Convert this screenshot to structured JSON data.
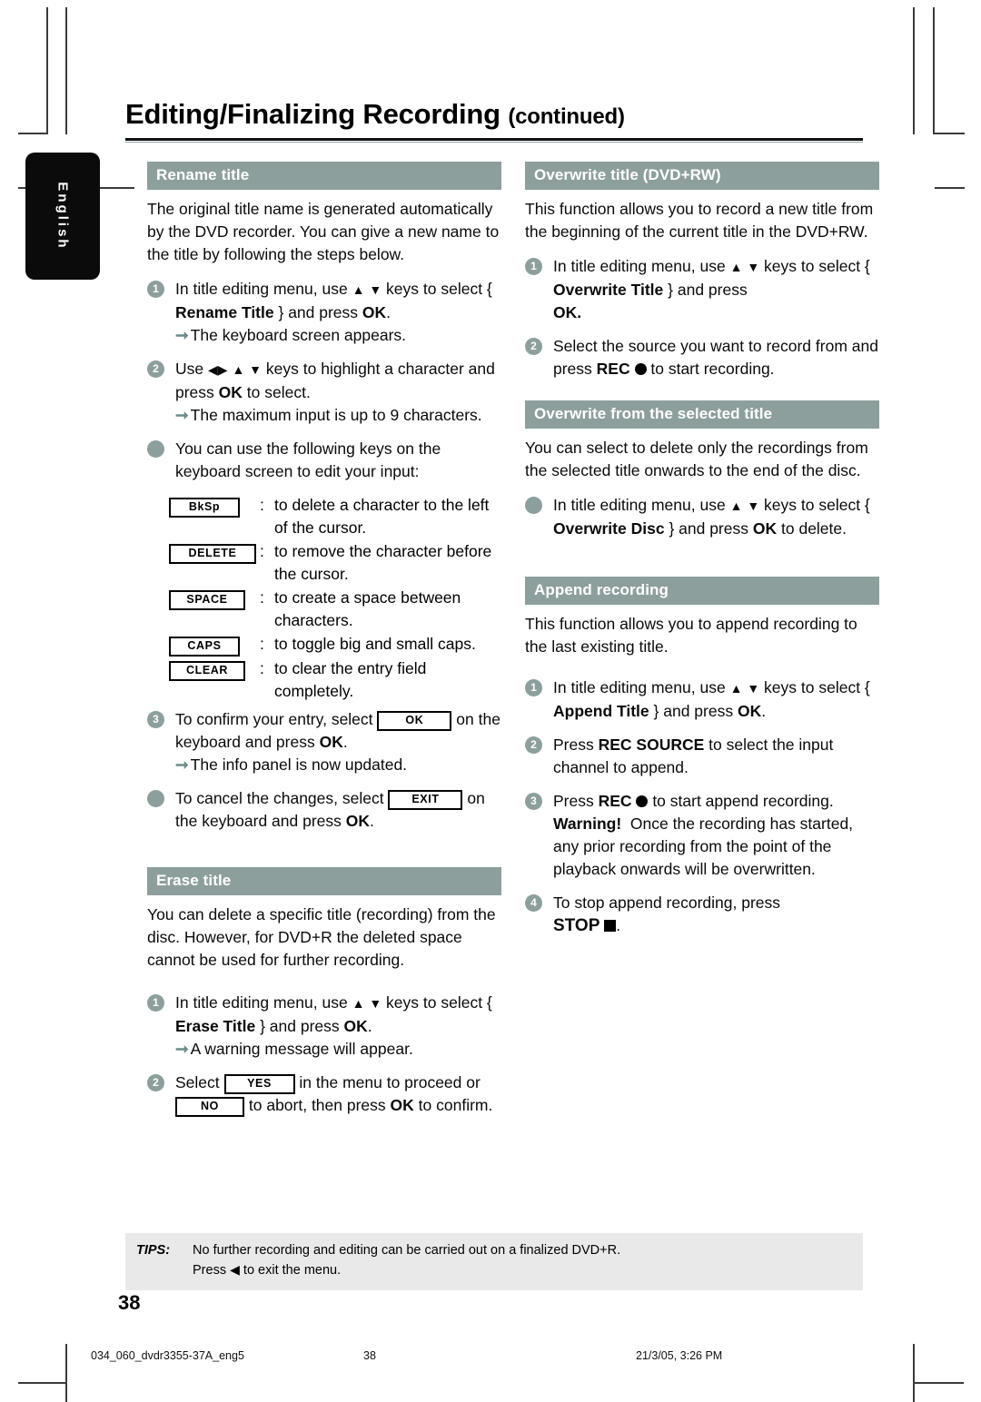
{
  "page": {
    "language_tab": "English",
    "page_number": "38",
    "title": "Editing/Finalizing Recording",
    "title_suffix": "(continued)"
  },
  "colors": {
    "section_bar": "#8d9f9d",
    "marker": "#8d9f9d",
    "arrow": "#6f8c8c",
    "tips_background": "#e9e9e9",
    "language_tab": "#0b0b0b"
  },
  "left_column": {
    "rename": {
      "heading": "Rename title",
      "intro": "The original title name is generated automatically by the DVD recorder. You can give a new name to the title by following the steps below.",
      "step1_marker": "1",
      "step1_line1_a": "In title editing menu, use",
      "step1_line1_b": "keys to select {",
      "step1_bold": "Rename Title",
      "step1_line1_c": "} and press",
      "step1_ok": "OK",
      "step1_end": ".",
      "step1_sub": "The keyboard screen appears.",
      "step2_marker": "2",
      "step2_a": "Use",
      "step2_b": "keys to highlight a character and press",
      "step2_ok": "OK",
      "step2_c": "to select.",
      "step2_sub": "The maximum input is up to 9 characters.",
      "bullet_intro": "You can use the following keys on the keyboard screen to edit your input:",
      "keys": [
        {
          "label": "BkSp",
          "width_class": "w-bksp",
          "desc": "to delete a character to the left of the cursor."
        },
        {
          "label": "DELETE",
          "width_class": "w-delete",
          "desc": "to remove the character before the cursor."
        },
        {
          "label": "SPACE",
          "width_class": "w-space",
          "desc": "to create a space between characters."
        },
        {
          "label": "CAPS",
          "width_class": "w-caps",
          "desc": "to toggle big and small caps."
        },
        {
          "label": "CLEAR",
          "width_class": "w-clear",
          "desc": "to clear the entry field completely."
        }
      ],
      "step3_marker": "3",
      "step3_a": "To confirm your entry, select",
      "step3_key": "OK",
      "step3_b": "on the keyboard and press",
      "step3_ok": "OK",
      "step3_end": ".",
      "step3_sub": "The info panel is now updated.",
      "cancel_a": "To cancel the changes, select",
      "cancel_key": "EXIT",
      "cancel_b": "on the keyboard and press",
      "cancel_ok": "OK",
      "cancel_end": "."
    },
    "erase": {
      "heading": "Erase title",
      "intro": "You can delete a specific title (recording) from the disc.  However, for DVD+R the deleted space cannot be used for further recording.",
      "step1_marker": "1",
      "step1_a": "In title editing menu, use",
      "step1_b": "keys to select {",
      "step1_bold": "Erase Title",
      "step1_c": "} and press",
      "step1_ok": "OK",
      "step1_end": ".",
      "step1_sub": "A warning message will appear.",
      "step2_marker": "2",
      "step2_a": "Select",
      "step2_yes": "YES",
      "step2_b": "in the menu to proceed or",
      "step2_no": "NO",
      "step2_c": "to abort, then press",
      "step2_ok": "OK",
      "step2_d": "to confirm."
    }
  },
  "right_column": {
    "overwrite_title": {
      "heading": "Overwrite title (DVD+RW)",
      "intro": "This function allows you to record a new title from the beginning of the current title in the DVD+RW.",
      "step1_marker": "1",
      "step1_a": "In title editing menu, use",
      "step1_b": "keys to select {",
      "step1_bold": "Overwrite Title",
      "step1_c": "} and press",
      "step1_ok": "OK",
      "step1_end": ".",
      "step2_marker": "2",
      "step2_a": "Select the source you want to record from and press",
      "step2_rec": "REC",
      "step2_b": "to start recording."
    },
    "overwrite_selected": {
      "heading": "Overwrite from the selected title",
      "intro": "You can select to delete only the recordings from the selected title onwards to the end of the disc.",
      "bullet_a": "In title editing menu, use",
      "bullet_b": "keys to select {",
      "bullet_bold": "Overwrite Disc",
      "bullet_c": "} and press",
      "bullet_ok": "OK",
      "bullet_d": "to delete."
    },
    "append": {
      "heading": "Append recording",
      "intro": "This function allows you to append recording to the last existing title.",
      "step1_marker": "1",
      "step1_a": "In title editing menu, use",
      "step1_b": "keys to select {",
      "step1_bold": "Append Title",
      "step1_c": "} and press",
      "step1_ok": "OK",
      "step1_end": ".",
      "step2_marker": "2",
      "step2_a": "Press",
      "step2_bold": "REC SOURCE",
      "step2_b": "to select the input channel to append.",
      "step3_marker": "3",
      "step3_a": "Press",
      "step3_bold": "REC",
      "step3_b": "to start append recording.",
      "warning_label": "Warning!",
      "warning_text": "Once the recording has started, any prior recording from the point of the playback onwards will be overwritten.",
      "step4_marker": "4",
      "step4_a": "To stop append recording, press",
      "step4_bold": "STOP",
      "step4_end": "."
    }
  },
  "tips": {
    "label": "TIPS:",
    "line1": "No further recording and editing can be carried out on a finalized DVD+R.",
    "line2_a": "Press",
    "line2_b": "to exit the menu."
  },
  "footer": {
    "file": "034_060_dvdr3355-37A_eng5",
    "page": "38",
    "date": "21/3/05, 3:26 PM"
  }
}
